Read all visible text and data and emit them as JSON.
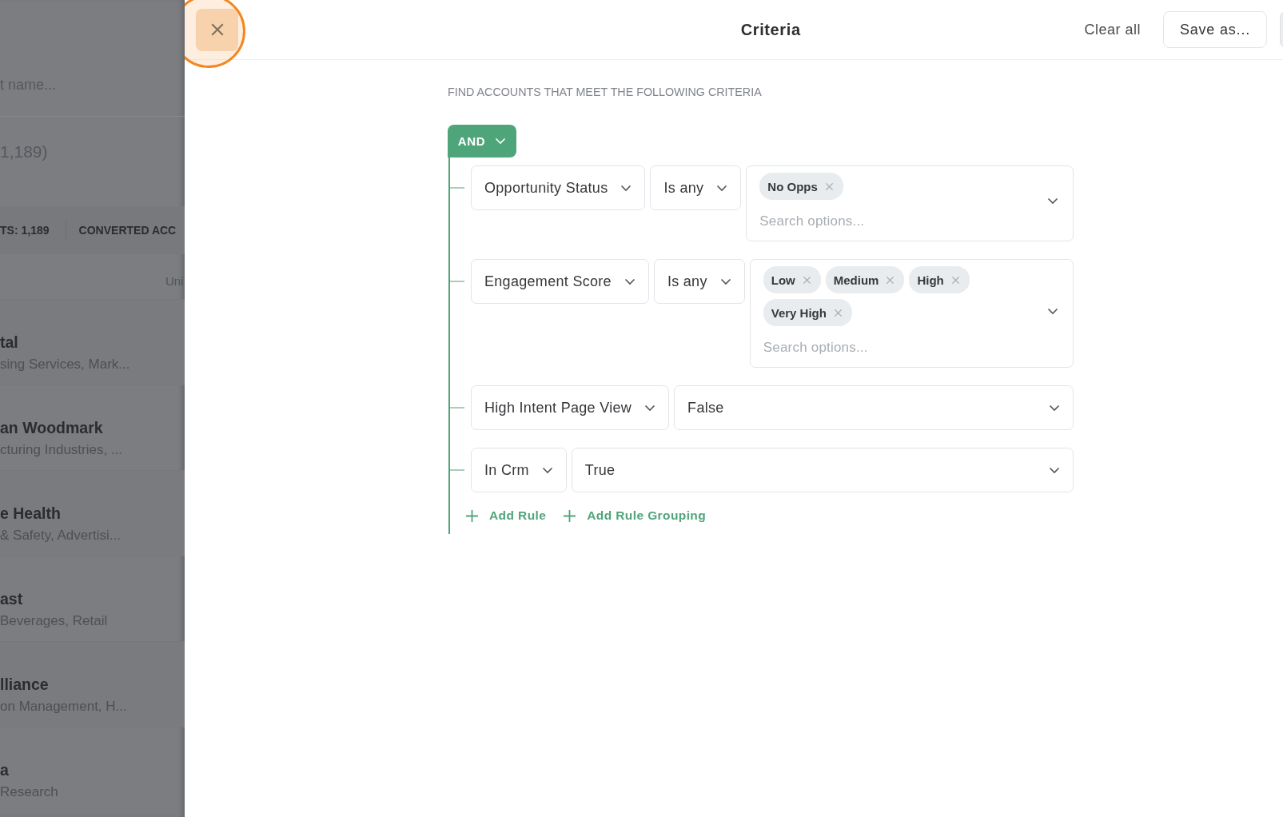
{
  "background_list": {
    "search_placeholder": "t name...",
    "count": "1,189)",
    "stats": [
      {
        "label": "TS:",
        "value": "1,189"
      },
      {
        "label": "CONVERTED ACC"
      }
    ],
    "column_1": "Uni",
    "rows": [
      {
        "name": "tal",
        "detail": "sing Services, Mark..."
      },
      {
        "name": "an Woodmark",
        "detail": "cturing Industries, ..."
      },
      {
        "name": "e Health",
        "detail": "& Safety, Advertisi..."
      },
      {
        "name": "ast",
        "detail": "Beverages, Retail"
      },
      {
        "name": "lliance",
        "detail": "on Management, H..."
      },
      {
        "name": "a",
        "detail": "Research"
      }
    ]
  },
  "header": {
    "title": "Criteria",
    "clear": "Clear all",
    "save": "Save as...",
    "close_highlighted": true
  },
  "criteria": {
    "heading": "FIND ACCOUNTS THAT MEET THE FOLLOWING CRITERIA",
    "operator": "AND",
    "rules": [
      {
        "kind": "multi",
        "field": "Opportunity Status",
        "op": "Is any",
        "tags": [
          "No Opps"
        ],
        "placeholder": "Search options..."
      },
      {
        "kind": "multi",
        "field": "Engagement Score",
        "op": "Is any",
        "tags": [
          "Low",
          "Medium",
          "High",
          "Very High"
        ],
        "placeholder": "Search options..."
      },
      {
        "kind": "single",
        "field": "High Intent Page View",
        "value": "False"
      },
      {
        "kind": "single",
        "field": "In Crm",
        "value": "True"
      }
    ],
    "actions": [
      "Add Rule",
      "Add Rule Grouping"
    ]
  }
}
